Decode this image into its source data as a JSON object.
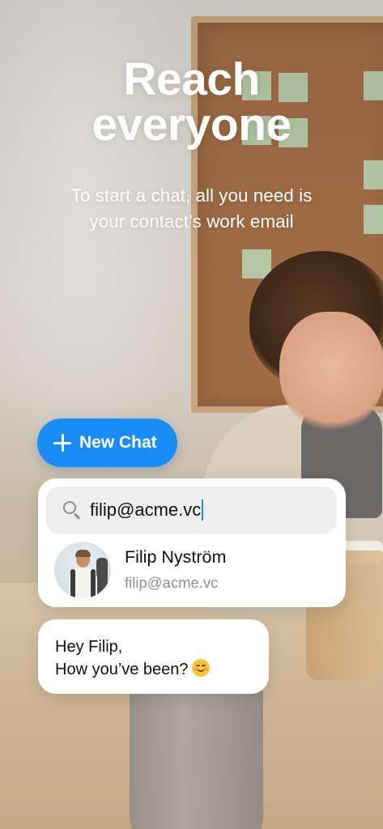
{
  "hero": {
    "title_line1": "Reach",
    "title_line2": "everyone",
    "subtitle_line1": "To start a chat, all you need is",
    "subtitle_line2": "your contact’s work email"
  },
  "new_chat": {
    "label": "New Chat",
    "icon": "plus-icon",
    "color": "#1a8cf5"
  },
  "search": {
    "icon": "search-icon",
    "value": "filip@acme.vc"
  },
  "contact": {
    "name": "Filip Nyström",
    "email": "filip@acme.vc"
  },
  "message": {
    "line1": "Hey Filip,",
    "line2": "How you’ve been?",
    "emoji": "smiling-face-emoji"
  }
}
